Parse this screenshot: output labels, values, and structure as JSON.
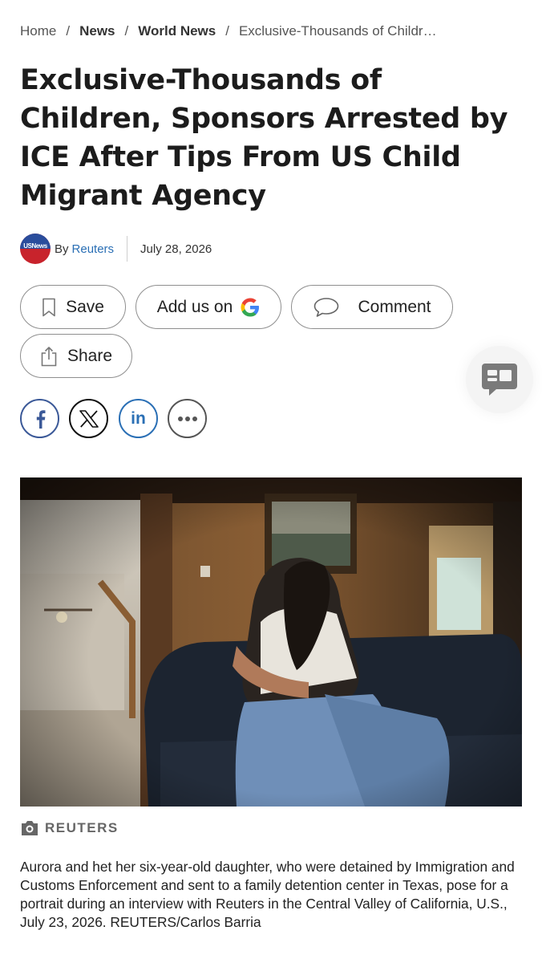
{
  "breadcrumb": {
    "home": "Home",
    "news": "News",
    "world": "World News",
    "current": "Exclusive-Thousands of Childr…",
    "separator": "/"
  },
  "article": {
    "title": "Exclusive-Thousands of Children, Sponsors Arrested by ICE After Tips From US Child Migrant Agency",
    "logo_text": "USNews",
    "by": "By",
    "author": "Reuters",
    "date": "July 28, 2026"
  },
  "actions": {
    "save": "Save",
    "add_us_on": "Add us on",
    "comment": "Comment",
    "share": "Share"
  },
  "social": {
    "linkedin": "in"
  },
  "photo": {
    "credit": "REUTERS",
    "caption": "Aurora and het her six-year-old daughter, who were detained by Immigration and Customs Enforcement and sent to a family detention center in Texas, pose for a portrait during an interview with Reuters in the Central Valley of California, U.S., July 23, 2026. REUTERS/Carlos Barria"
  },
  "icons": [
    "bookmark-icon",
    "google-icon",
    "comment-icon",
    "share-icon",
    "chat-icon",
    "facebook-icon",
    "x-icon",
    "linkedin-icon",
    "more-icon",
    "camera-icon"
  ],
  "colors": {
    "link": "#2a6fb5",
    "facebook": "#3b5998",
    "text": "#1c1c1c"
  }
}
